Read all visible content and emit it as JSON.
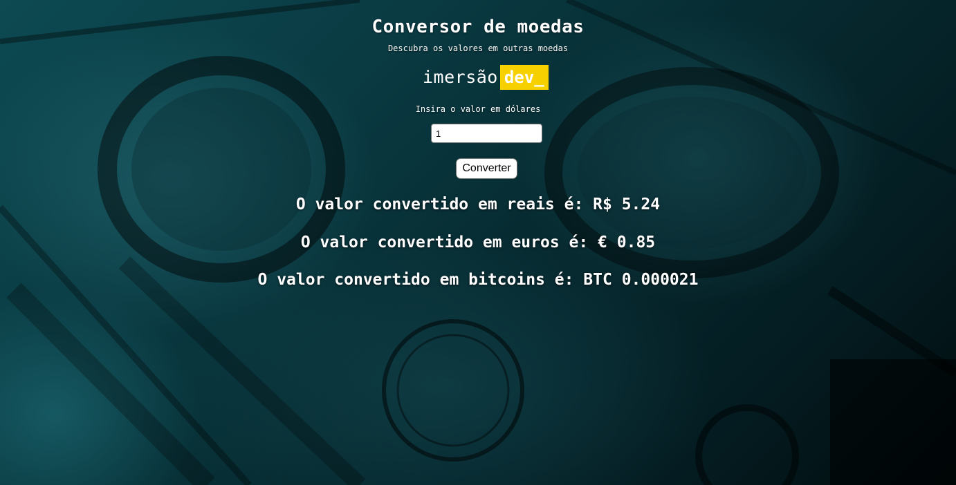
{
  "header": {
    "title": "Conversor de moedas",
    "subtitle": "Descubra os valores em outras moedas"
  },
  "logo": {
    "text": "imersão",
    "badge": "dev_",
    "badge_color": "#f7d000"
  },
  "form": {
    "label": "Insira o valor em dólares",
    "input_value": "1",
    "button_label": "Converter"
  },
  "results": {
    "reais": "O valor convertido em reais é: R$ 5.24",
    "euros": "O valor convertido em euros é: € 0.85",
    "bitcoin": "O valor convertido em bitcoins é: BTC 0.000021"
  },
  "theme": {
    "background": "#0a3a42",
    "text_color": "#ffffff"
  }
}
